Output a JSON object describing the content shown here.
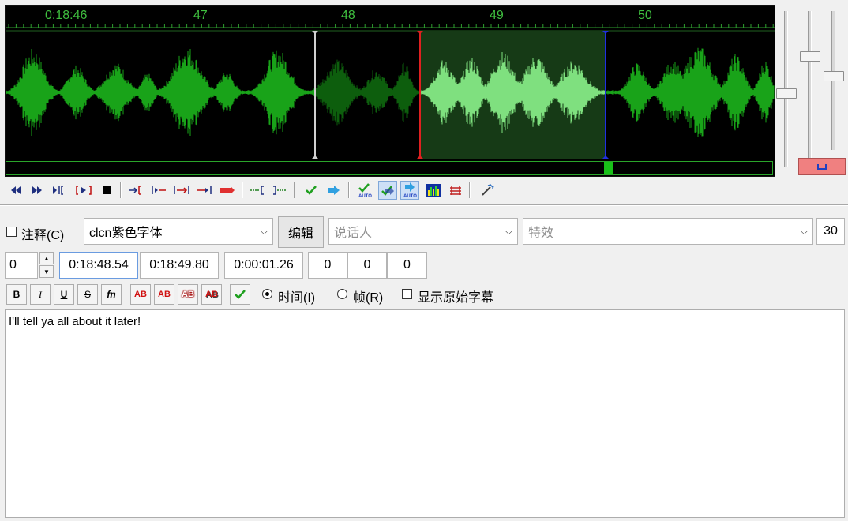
{
  "ruler": {
    "labels": [
      "0:18:46",
      "47",
      "48",
      "49",
      "50"
    ]
  },
  "waveform": {
    "colors": {
      "background": "#000000",
      "wave": "#19a319",
      "wave_dim": "#0d5e0d",
      "wave_selected": "#7fe07f",
      "selection_bg": "#163a16",
      "start_marker": "#e02020",
      "end_marker": "#2030e0",
      "prev_marker": "#d0d0d0"
    },
    "scroll_position": 0.79
  },
  "toolbar": {
    "icons": [
      "rewind-icon",
      "fast-forward-icon",
      "play-from-start-icon",
      "play-selection-icon",
      "stop-icon",
      "set-start-icon",
      "play-begin-icon",
      "play-region-icon",
      "play-end-icon",
      "play-after-icon",
      "set-begin-icon",
      "set-end-icon",
      "commit-check-icon",
      "next-arrow-icon",
      "auto-commit-icon",
      "auto-check-icon",
      "auto-next-icon",
      "spectrum-icon",
      "split-icon",
      "wand-icon"
    ]
  },
  "row1": {
    "comment_checkbox": {
      "label": "注释(C)",
      "checked": false
    },
    "style_select": {
      "value": "clcn紫色字体"
    },
    "edit_button": "编辑",
    "actor_select": {
      "placeholder": "说话人"
    },
    "effect_select": {
      "placeholder": "特效"
    },
    "layer_value": "30"
  },
  "row2": {
    "layer": "0",
    "start_time": "0:18:48.54",
    "end_time": "0:18:49.80",
    "duration": "0:00:01.26",
    "margin_l": "0",
    "margin_r": "0",
    "margin_v": "0"
  },
  "row3": {
    "bold": "B",
    "italic": "I",
    "underline": "U",
    "strike": "S",
    "fn": "fn",
    "color_buttons": [
      "AB",
      "AB",
      "AB",
      "AB"
    ],
    "color_values": [
      "#d01010",
      "#d01010",
      "#a00000",
      "#d01010"
    ],
    "time_radio": {
      "label": "时间(I)",
      "checked": true
    },
    "frame_radio": {
      "label": "帧(R)",
      "checked": false
    },
    "show_original": {
      "label": "显示原始字幕",
      "checked": false
    }
  },
  "text": {
    "content": "I'll tell ya all about it later!"
  }
}
